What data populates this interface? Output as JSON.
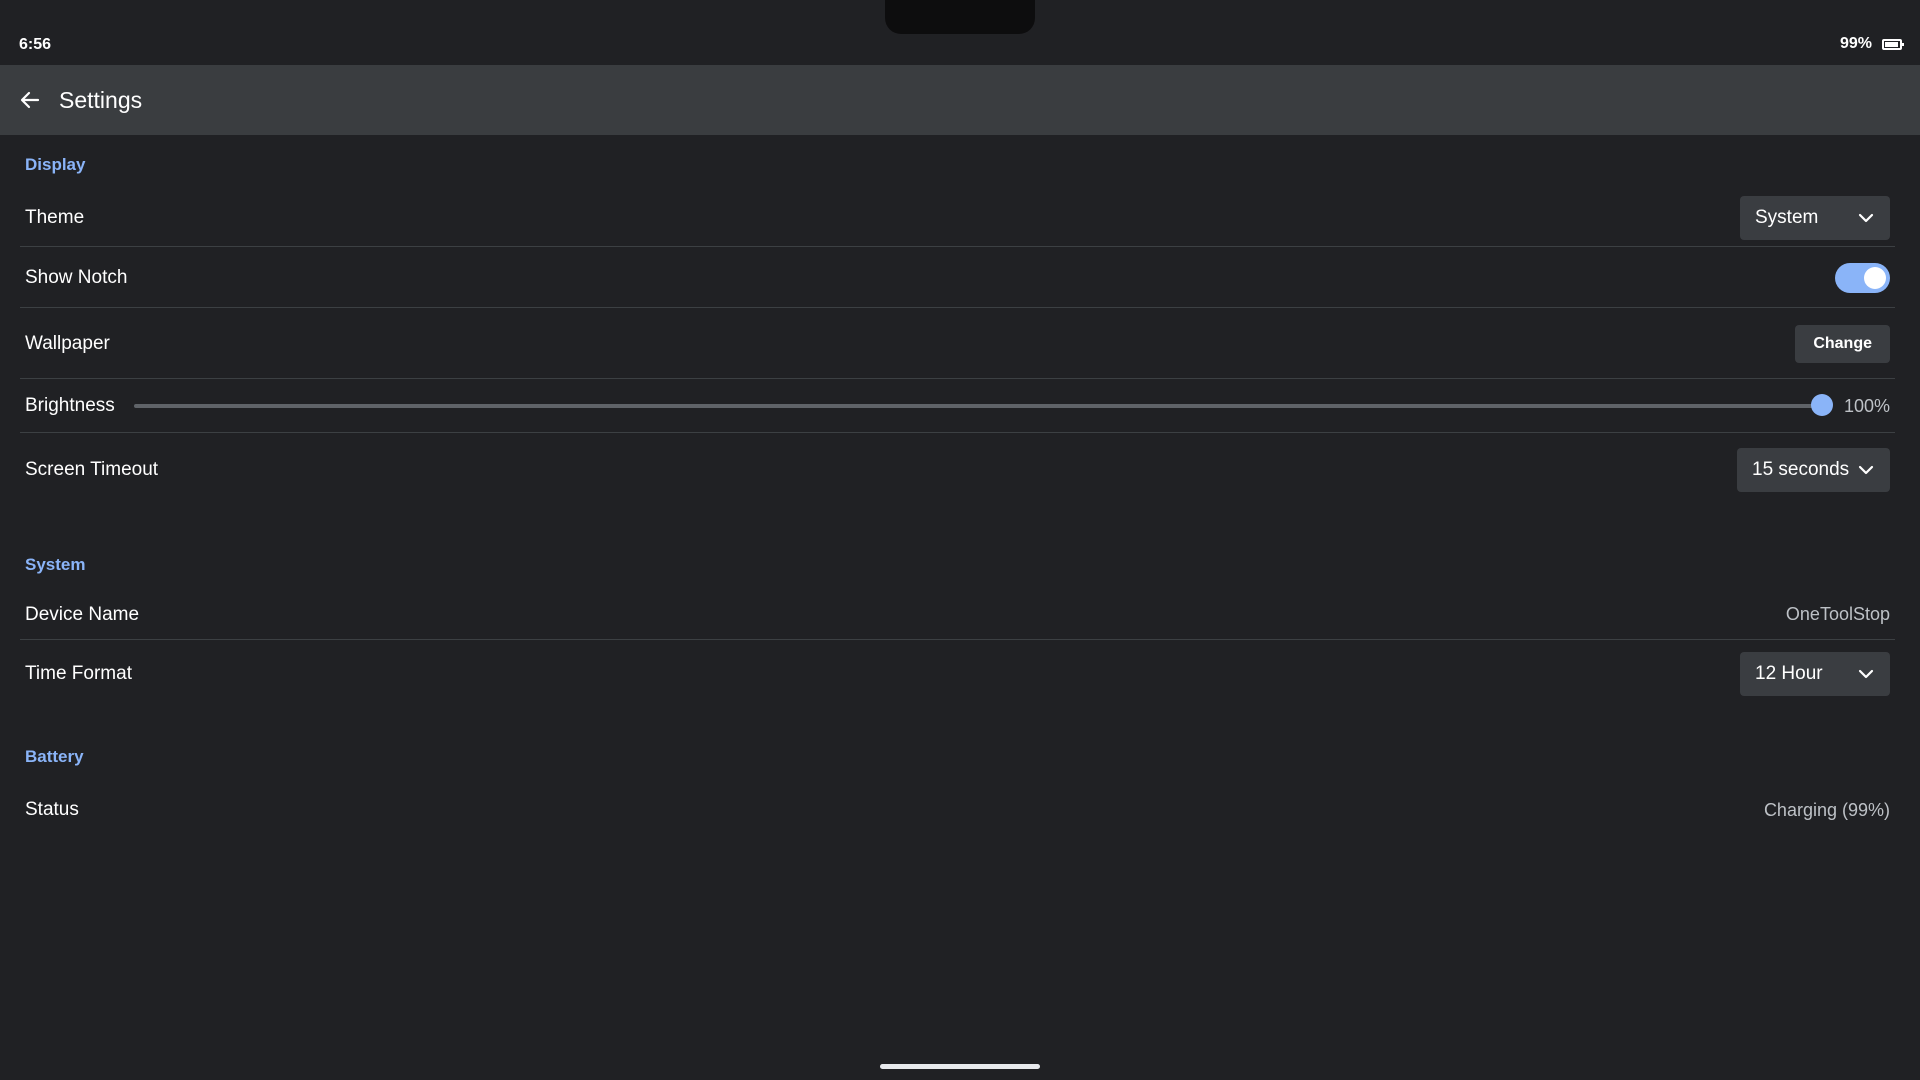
{
  "status_bar": {
    "time": "6:56",
    "battery_percent": "99%",
    "battery_icon": "battery-full-icon"
  },
  "app_bar": {
    "back_icon": "arrow-left-icon",
    "title": "Settings"
  },
  "sections": {
    "display": {
      "header": "Display",
      "theme": {
        "label": "Theme",
        "value": "System"
      },
      "show_notch": {
        "label": "Show Notch",
        "enabled": true
      },
      "wallpaper": {
        "label": "Wallpaper",
        "button": "Change"
      },
      "brightness": {
        "label": "Brightness",
        "value_text": "100%",
        "value": 1.0
      },
      "screen_timeout": {
        "label": "Screen Timeout",
        "value": "15 seconds"
      }
    },
    "system": {
      "header": "System",
      "device_name": {
        "label": "Device Name",
        "value": "OneToolStop"
      },
      "time_format": {
        "label": "Time Format",
        "value": "12 Hour"
      }
    },
    "battery": {
      "header": "Battery",
      "status": {
        "label": "Status",
        "value": "Charging (99%)"
      }
    }
  },
  "colors": {
    "background": "#202124",
    "app_bar": "#3a3d40",
    "accent": "#8ab4f8",
    "control": "#3a3d41"
  }
}
